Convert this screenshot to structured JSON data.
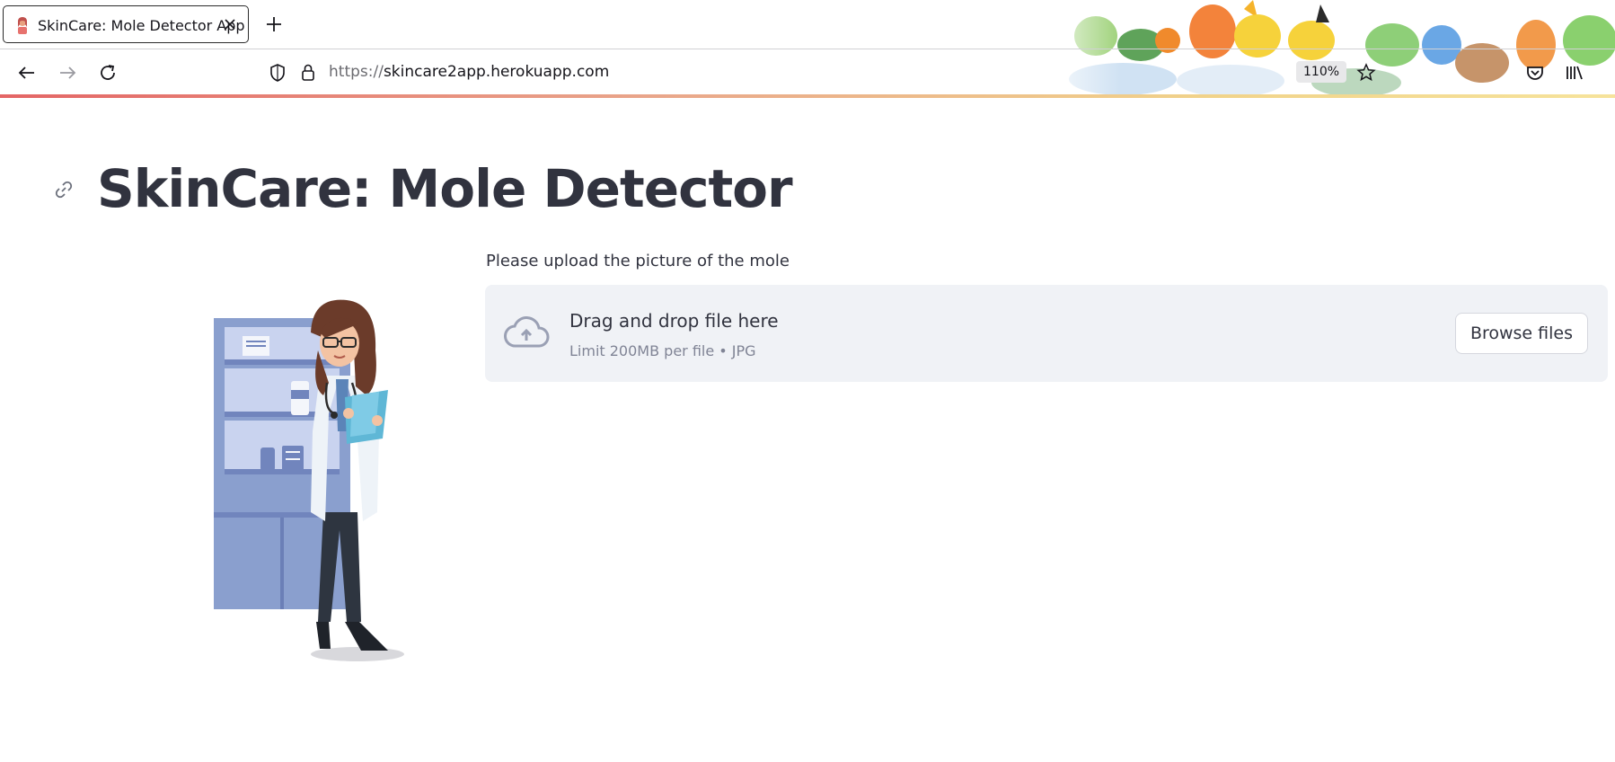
{
  "browser": {
    "tab": {
      "title": "SkinCare: Mole Detector App"
    },
    "address": {
      "scheme": "https://",
      "host": "skincare2app.herokuapp.com"
    },
    "zoom": "110%"
  },
  "page": {
    "title": "SkinCare: Mole Detector",
    "uploader": {
      "label": "Please upload the picture of the mole",
      "drop_title": "Drag and drop file here",
      "drop_subtitle": "Limit 200MB per file • JPG",
      "browse_label": "Browse files"
    }
  },
  "colors": {
    "text": "#31333f",
    "muted": "#808495",
    "dropzone_bg": "#f0f2f6",
    "accent_gradient_start": "#e46565"
  },
  "icons": [
    "tab-favicon",
    "close-icon",
    "plus-icon",
    "back-arrow-icon",
    "forward-arrow-icon",
    "reload-icon",
    "shield-icon",
    "lock-icon",
    "star-icon",
    "pocket-icon",
    "library-icon",
    "link-icon",
    "cloud-upload-icon"
  ]
}
